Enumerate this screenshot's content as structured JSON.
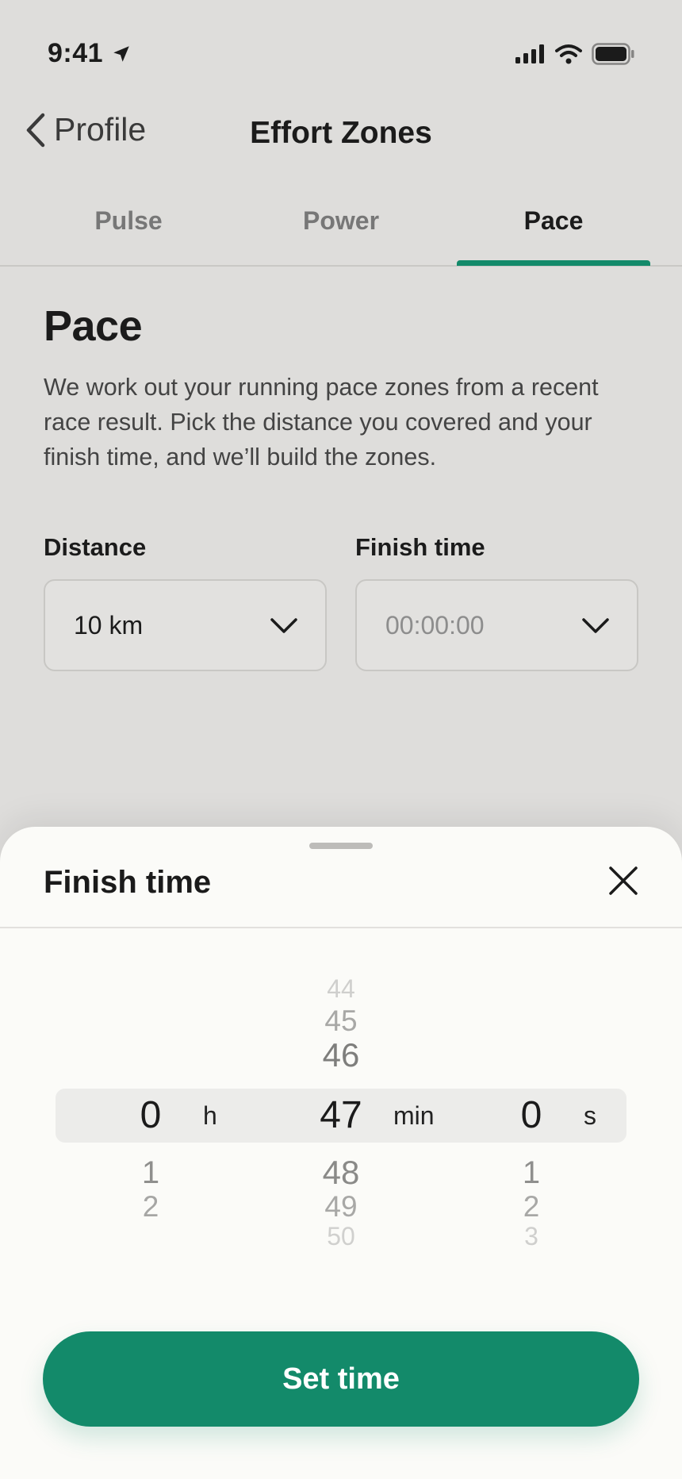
{
  "status_bar": {
    "time": "9:41"
  },
  "nav": {
    "back_label": "Profile",
    "title": "Effort Zones"
  },
  "tabs": [
    {
      "label": "Pulse",
      "active": false
    },
    {
      "label": "Power",
      "active": false
    },
    {
      "label": "Pace",
      "active": true
    }
  ],
  "content": {
    "title": "Pace",
    "description": "We work out your running pace zones from a recent race result. Pick the distance you covered and your finish time, and we’ll build the zones."
  },
  "fields": {
    "distance": {
      "label": "Distance",
      "value": "10 km"
    },
    "finish_time": {
      "label": "Finish time",
      "placeholder": "00:00:00"
    }
  },
  "sheet": {
    "title": "Finish time",
    "hours": {
      "above": [],
      "selected": "0",
      "below": [
        "1",
        "2"
      ],
      "unit": "h"
    },
    "minutes": {
      "above": [
        "44",
        "45",
        "46"
      ],
      "selected": "47",
      "below": [
        "48",
        "49",
        "50"
      ],
      "unit": "min"
    },
    "seconds": {
      "above": [],
      "selected": "0",
      "below": [
        "1",
        "2",
        "3"
      ],
      "unit": "s"
    },
    "button_label": "Set time"
  },
  "colors": {
    "accent": "#138a6a",
    "background": "#dedddb",
    "sheet": "#fbfbf8"
  }
}
